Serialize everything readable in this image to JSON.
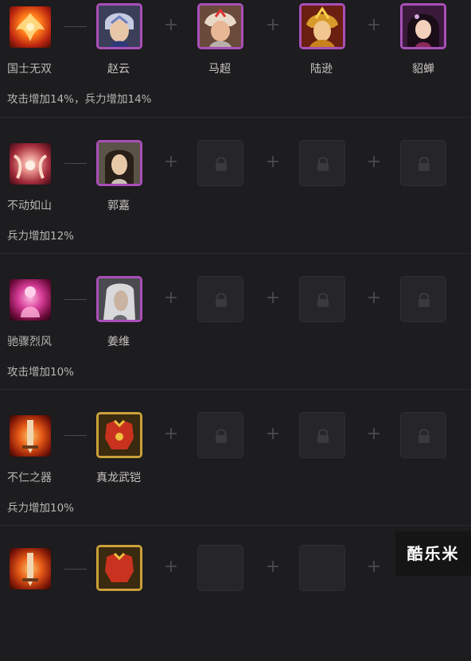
{
  "rows": [
    {
      "skill_icon": "phoenix-icon",
      "skill_name": "国士无双",
      "bonus": "攻击增加14%，兵力增加14%",
      "heroes": [
        "赵云",
        "马超",
        "陆逊",
        "貂蝉"
      ]
    },
    {
      "skill_icon": "mirror-aura-icon",
      "skill_name": "不动如山",
      "bonus": "兵力增加12%",
      "heroes": [
        "郭嘉"
      ]
    },
    {
      "skill_icon": "crimson-spirit-icon",
      "skill_name": "驰骤烈风",
      "bonus": "攻击增加10%",
      "heroes": [
        "姜维"
      ]
    },
    {
      "skill_icon": "flaming-blade-icon",
      "skill_name": "不仁之器",
      "bonus": "兵力增加10%",
      "heroes": [
        "真龙武铠"
      ]
    },
    {
      "skill_icon": "flaming-blade-icon",
      "skill_name": "",
      "bonus": "",
      "heroes": []
    }
  ],
  "watermark": "酷乐米",
  "colors": {
    "background": "#1d1c1e",
    "hero_frame": "#a94fb8",
    "item_frame": "#caa03a",
    "text": "#b9b7b3"
  }
}
